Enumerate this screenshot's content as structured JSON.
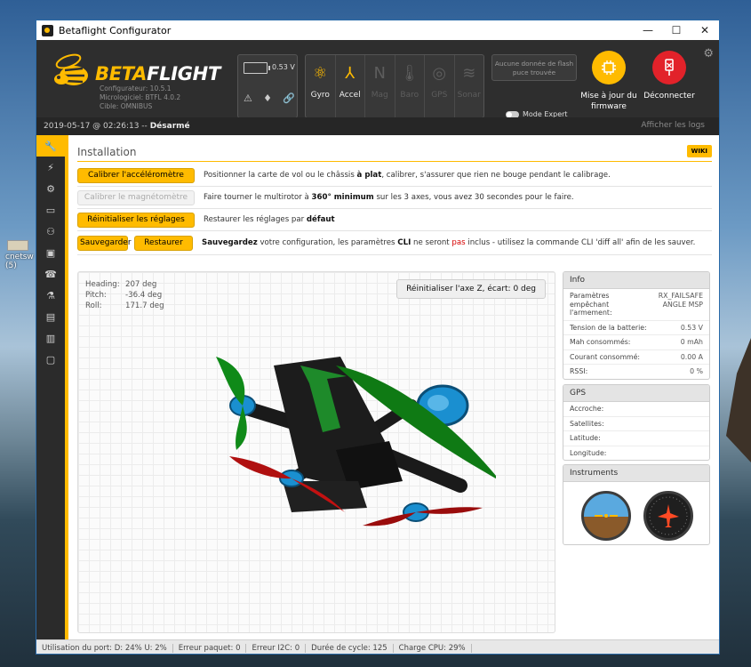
{
  "desktop": {
    "label": "cnetsw\n(5)"
  },
  "window": {
    "title": "Betaflight Configurator",
    "minimize": "—",
    "maximize": "☐",
    "close": "✕"
  },
  "header": {
    "brand_a": "BETA",
    "brand_b": "FLIGHT",
    "configurator": "Configurateur: 10.5.1",
    "firmware": "Micrologiciel: BTFL 4.0.2",
    "target": "Cible: OMNIBUS",
    "battery_voltage": "0.53 V",
    "sensors": [
      {
        "label": "Gyro",
        "state": "on",
        "icon": "gyro-icon",
        "glyph": "⚛"
      },
      {
        "label": "Accel",
        "state": "on",
        "icon": "accel-icon",
        "glyph": "⅄"
      },
      {
        "label": "Mag",
        "state": "off",
        "icon": "mag-icon",
        "glyph": "N"
      },
      {
        "label": "Baro",
        "state": "off",
        "icon": "baro-icon",
        "glyph": "🌡"
      },
      {
        "label": "GPS",
        "state": "off",
        "icon": "gps-icon",
        "glyph": "◎"
      },
      {
        "label": "Sonar",
        "state": "off",
        "icon": "sonar-icon",
        "glyph": "≋"
      }
    ],
    "flash": "Aucune donnée de flash puce trouvée",
    "expert_mode": "Mode Expert",
    "update_firmware": "Mise à jour du firmware",
    "disconnect": "Déconnecter",
    "show_logs": "Afficher les logs"
  },
  "statusline": {
    "datetime": "2019-05-17 @ 02:26:13 --",
    "state": "Désarmé"
  },
  "sidebar": [
    {
      "icon": "wrench-icon",
      "glyph": "🔧"
    },
    {
      "icon": "plug-icon",
      "glyph": "⚡"
    },
    {
      "icon": "gear-icon",
      "glyph": "⚙"
    },
    {
      "icon": "ports-icon",
      "glyph": "▭"
    },
    {
      "icon": "network-icon",
      "glyph": "⚇"
    },
    {
      "icon": "motor-icon",
      "glyph": "▣"
    },
    {
      "icon": "receiver-icon",
      "glyph": "☎"
    },
    {
      "icon": "flask-icon",
      "glyph": "⚗"
    },
    {
      "icon": "osd-icon",
      "glyph": "▤"
    },
    {
      "icon": "chip-icon",
      "glyph": "▥"
    },
    {
      "icon": "cli-icon",
      "glyph": "▢"
    }
  ],
  "page": {
    "title": "Installation",
    "wiki": "WIKI",
    "calibrate_acc": "Calibrer l'accéléromètre",
    "calibrate_acc_desc_a": "Positionner la carte de vol ou le châssis ",
    "calibrate_acc_desc_b": "à plat",
    "calibrate_acc_desc_c": ", calibrer, s'assurer que rien ne bouge pendant le calibrage.",
    "calibrate_mag": "Calibrer le magnétomètre",
    "calibrate_mag_desc_a": "Faire tourner le multirotor à ",
    "calibrate_mag_desc_b": "360° minimum",
    "calibrate_mag_desc_c": " sur les 3 axes, vous avez 30 secondes pour le faire.",
    "reset": "Réinitialiser les réglages",
    "reset_desc_a": "Restaurer les réglages par ",
    "reset_desc_b": "défaut",
    "backup": "Sauvegarder",
    "restore": "Restaurer",
    "backup_desc_a": "Sauvegardez",
    "backup_desc_b": " votre configuration, les paramètres ",
    "backup_desc_c": "CLI",
    "backup_desc_d": " ne seront ",
    "backup_desc_e": "pas",
    "backup_desc_f": " inclus - utilisez la commande CLI 'diff all' afin de les sauver.",
    "heading_label": "Heading:",
    "heading": "207 deg",
    "pitch_label": "Pitch:",
    "pitch": "-36.4 deg",
    "roll_label": "Roll:",
    "roll": "171.7 deg",
    "reset_z": "Réinitialiser l'axe Z, écart: 0 deg"
  },
  "info": {
    "title": "Info",
    "rows": [
      {
        "k": "Paramètres empêchant l'armement:",
        "v": "RX_FAILSAFE ANGLE MSP"
      },
      {
        "k": "Tension de la batterie:",
        "v": "0.53 V"
      },
      {
        "k": "Mah consommés:",
        "v": "0 mAh"
      },
      {
        "k": "Courant consommé:",
        "v": "0.00 A"
      },
      {
        "k": "RSSI:",
        "v": "0 %"
      }
    ]
  },
  "gps": {
    "title": "GPS",
    "rows": [
      {
        "k": "Accroche:",
        "v": ""
      },
      {
        "k": "Satellites:",
        "v": ""
      },
      {
        "k": "Latitude:",
        "v": ""
      },
      {
        "k": "Longitude:",
        "v": ""
      }
    ]
  },
  "instruments": {
    "title": "Instruments"
  },
  "footer": [
    "Utilisation du port: D: 24% U: 2%",
    "Erreur paquet: 0",
    "Erreur I2C: 0",
    "Durée de cycle: 125",
    "Charge CPU: 29%"
  ],
  "colors": {
    "accent": "#ffbb00",
    "disconnect": "#e2222a",
    "header": "#2e2e2e"
  }
}
